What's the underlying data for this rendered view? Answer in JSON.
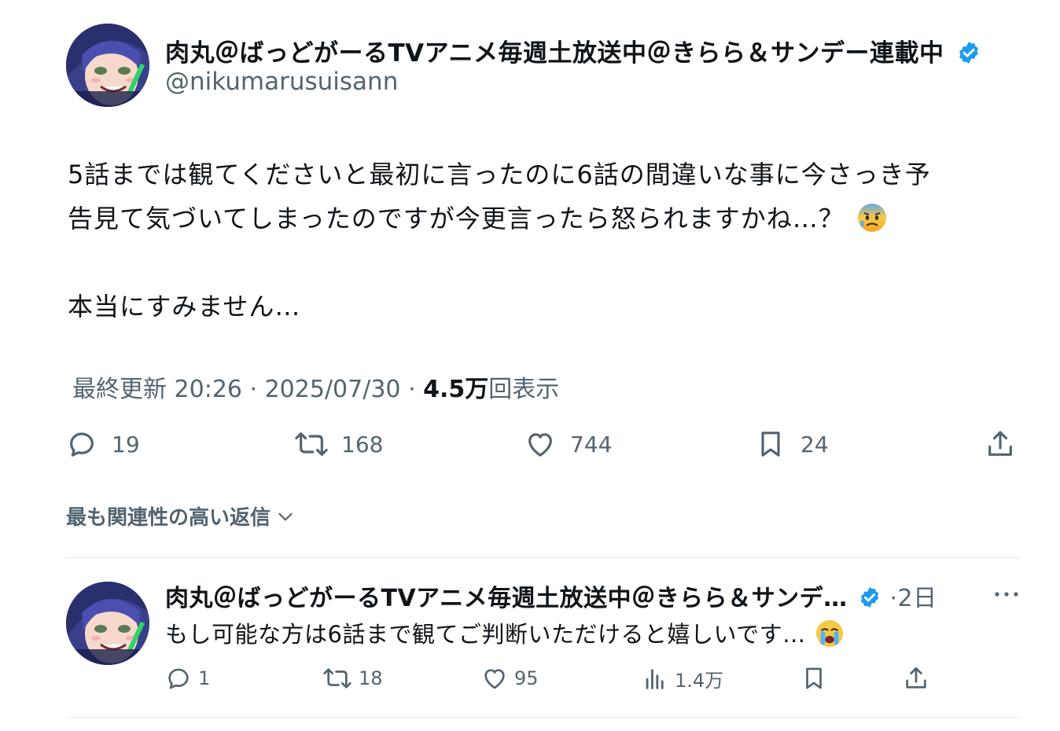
{
  "tweet": {
    "author": {
      "display_name": "肉丸＠ばっどがーるTVアニメ毎週土放送中＠きらら＆サンデー連載中",
      "handle": "@nikumarusuisann",
      "avatar_icon": "anime-girl-avatar",
      "verified_icon": "verified-badge-icon"
    },
    "text_lines": [
      "5話までは観てくださいと最初に言ったのに6話の間違いな事に今さっき予",
      "告見て気づいてしまったのですが今更言ったら怒られますかね…？",
      "本当にすみません…"
    ],
    "emoji_line2": "anxious-face-with-sweat",
    "meta": {
      "updated_label": "最終更新 20:26 · 2025/07/30",
      "views_sep": " · ",
      "views_count": "4.5万",
      "views_label": "回表示"
    },
    "actions": {
      "reply_count": "19",
      "retweet_count": "168",
      "like_count": "744",
      "bookmark_count": "24"
    }
  },
  "replies_sort_label": "最も関連性の高い返信",
  "reply": {
    "display_name": "肉丸＠ばっどがーるTVアニメ毎週土放送中＠きらら＆サンデ…",
    "time": "·2日",
    "text": "もし可能な方は6話まで観てご判断いただけると嬉しいです…",
    "emoji": "loudly-crying-face",
    "actions": {
      "reply_count": "1",
      "retweet_count": "18",
      "like_count": "95",
      "views_count": "1.4万"
    }
  },
  "colors": {
    "text": "#0f1419",
    "muted": "#536471",
    "verified": "#1d9bf0",
    "divider": "#e6ecf0"
  }
}
